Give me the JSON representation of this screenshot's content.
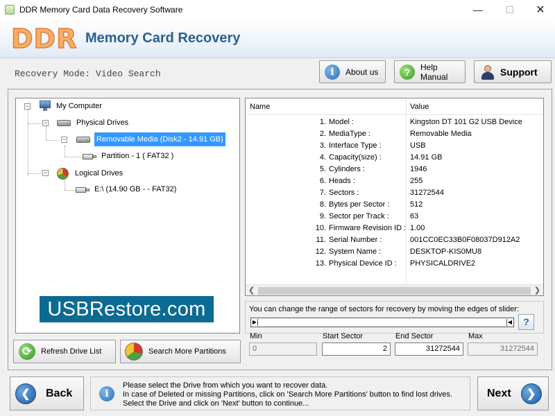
{
  "window": {
    "title": "DDR Memory Card Data Recovery Software",
    "minimize": "—",
    "maximize": "☐",
    "close": "✕"
  },
  "header": {
    "logo": "DDR",
    "title": "Memory Card Recovery"
  },
  "mode": {
    "text": "Recovery Mode: Video Search"
  },
  "top_buttons": {
    "about": "About us",
    "help": "Help Manual",
    "support": "Support"
  },
  "tree": {
    "root": "My Computer",
    "physical": "Physical Drives",
    "removable": "Removable Media (Disk2 - 14.91 GB)",
    "partition": "Partition - 1 ( FAT32 )",
    "logical": "Logical Drives",
    "drive_e": "E:\\ (14.90 GB -  - FAT32)"
  },
  "banner": "USBRestore.com",
  "left_buttons": {
    "refresh": "Refresh Drive List",
    "search": "Search More Partitions"
  },
  "properties": {
    "col_name": "Name",
    "col_value": "Value",
    "rows": [
      {
        "num": "1.",
        "name": "Model :",
        "value": "Kingston DT 101 G2 USB Device"
      },
      {
        "num": "2.",
        "name": "MediaType :",
        "value": "Removable Media"
      },
      {
        "num": "3.",
        "name": "Interface Type :",
        "value": "USB"
      },
      {
        "num": "4.",
        "name": "Capacity(size) :",
        "value": "14.91 GB"
      },
      {
        "num": "5.",
        "name": "Cylinders :",
        "value": "1946"
      },
      {
        "num": "6.",
        "name": "Heads :",
        "value": "255"
      },
      {
        "num": "7.",
        "name": "Sectors :",
        "value": "31272544"
      },
      {
        "num": "8.",
        "name": "Bytes per Sector :",
        "value": "512"
      },
      {
        "num": "9.",
        "name": "Sector per Track :",
        "value": "63"
      },
      {
        "num": "10.",
        "name": "Firmware Revision ID :",
        "value": "1.00"
      },
      {
        "num": "11.",
        "name": "Serial Number :",
        "value": "001CC0EC33B0F08037D912A2"
      },
      {
        "num": "12.",
        "name": "System Name :",
        "value": "DESKTOP-KIS0MU8"
      },
      {
        "num": "13.",
        "name": "Physical Device ID :",
        "value": "PHYSICALDRIVE2"
      }
    ]
  },
  "slider": {
    "hint": "You can change the range of sectors for recovery by moving the edges of slider:",
    "help": "?",
    "min_label": "Min",
    "min_value": "0",
    "start_label": "Start Sector",
    "start_value": "2",
    "end_label": "End Sector",
    "end_value": "31272544",
    "max_label": "Max",
    "max_value": "31272544"
  },
  "footer": {
    "back": "Back",
    "next": "Next",
    "info_lines": [
      "Please select the Drive from which you want to recover data.",
      "In case of Deleted or missing Partitions, click on 'Search More Partitions' button to find lost drives.",
      "Select the Drive and click on 'Next' button to continue..."
    ]
  },
  "colors": {
    "accent": "#2a5f93",
    "logo": "#f7ae69",
    "banner": "#0b6b93",
    "selection": "#3399ff"
  }
}
